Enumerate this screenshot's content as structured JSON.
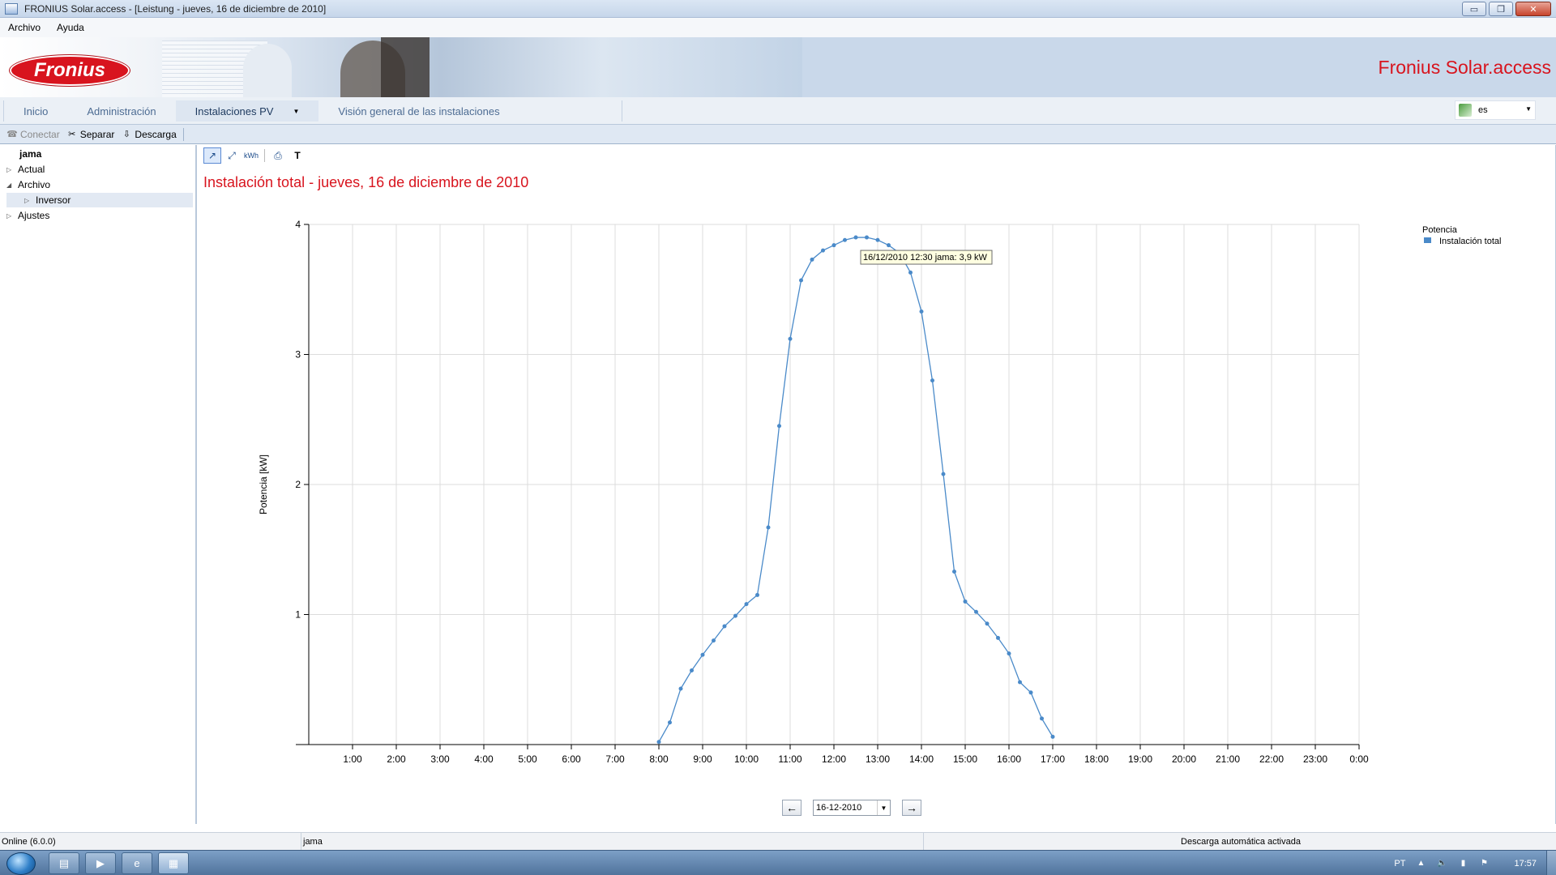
{
  "window": {
    "title": "FRONIUS Solar.access - [Leistung - jueves, 16 de diciembre de 2010]",
    "controls": {
      "minimize": "▭",
      "maximize": "❐",
      "close": "✕"
    }
  },
  "menu": {
    "items": [
      "Archivo",
      "Ayuda"
    ]
  },
  "banner": {
    "logo_text": "Fronius",
    "app_title": "Fronius Solar.access"
  },
  "nav": {
    "tabs": [
      "Inicio",
      "Administración",
      "Instalaciones PV",
      "Visión general de las instalaciones"
    ],
    "active_tab": "Instalaciones PV",
    "language": "es"
  },
  "toolbar": {
    "connect": "Conectar",
    "disconnect": "Separar",
    "download": "Descarga"
  },
  "tree": {
    "root": "jama",
    "items": [
      {
        "label": "Actual",
        "expanded": false
      },
      {
        "label": "Archivo",
        "expanded": true
      },
      {
        "label": "Inversor",
        "expanded": false,
        "selected": true
      },
      {
        "label": "Ajustes",
        "expanded": false
      }
    ]
  },
  "chart_tools": {
    "icons": [
      "line-cursor-icon",
      "zoom-icon",
      "kwh-icon",
      "print-icon",
      "text-icon"
    ],
    "kwh_label": "kWh",
    "text_label": "T"
  },
  "main": {
    "heading": "Instalación total - jueves, 16 de diciembre de 2010",
    "date_value": "16-12-2010"
  },
  "colors": {
    "accent": "#d8141e",
    "series": "#4a8ac9"
  },
  "chart_data": {
    "type": "line",
    "title": "Instalación total - jueves, 16 de diciembre de 2010",
    "xlabel": "",
    "ylabel": "Potencia [kW]",
    "ylim": [
      0,
      4
    ],
    "xlim": [
      0,
      24
    ],
    "y_ticks": [
      "1",
      "2",
      "3",
      "4"
    ],
    "x_ticks": [
      "1:00",
      "2:00",
      "3:00",
      "4:00",
      "5:00",
      "6:00",
      "7:00",
      "8:00",
      "9:00",
      "10:00",
      "11:00",
      "12:00",
      "13:00",
      "14:00",
      "15:00",
      "16:00",
      "17:00",
      "18:00",
      "19:00",
      "20:00",
      "21:00",
      "22:00",
      "23:00",
      "0:00"
    ],
    "grid": true,
    "legend": {
      "title": "Potencia",
      "position": "top-right"
    },
    "series": [
      {
        "name": "Instalación total",
        "x": [
          8.0,
          8.25,
          8.5,
          8.75,
          9.0,
          9.25,
          9.5,
          9.75,
          10.0,
          10.25,
          10.5,
          10.75,
          11.0,
          11.25,
          11.5,
          11.75,
          12.0,
          12.25,
          12.5,
          12.75,
          13.0,
          13.25,
          13.5,
          13.75,
          14.0,
          14.25,
          14.5,
          14.75,
          15.0,
          15.25,
          15.5,
          15.75,
          16.0,
          16.25,
          16.5,
          16.75,
          17.0
        ],
        "values": [
          0.02,
          0.17,
          0.43,
          0.57,
          0.69,
          0.8,
          0.91,
          0.99,
          1.08,
          1.15,
          1.67,
          2.45,
          3.12,
          3.57,
          3.73,
          3.8,
          3.84,
          3.88,
          3.9,
          3.9,
          3.88,
          3.84,
          3.78,
          3.63,
          3.33,
          2.8,
          2.08,
          1.33,
          1.1,
          1.02,
          0.93,
          0.82,
          0.7,
          0.48,
          0.4,
          0.2,
          0.06
        ]
      }
    ],
    "tooltip": "16/12/2010 12:30 jama: 3,9 kW"
  },
  "status": {
    "version": "Online (6.0.0)",
    "plant": "jama",
    "message": "Descarga automática activada"
  },
  "taskbar": {
    "lang": "PT",
    "time": "17:57"
  }
}
